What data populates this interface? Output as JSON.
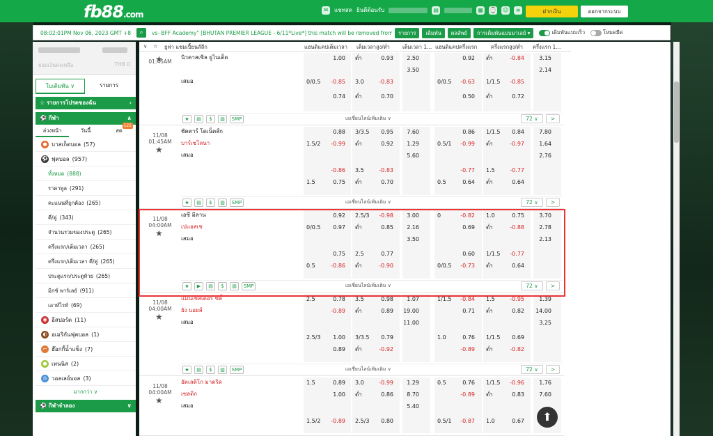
{
  "header": {
    "logo": "fb88",
    "logo_suffix": ".com",
    "chat": "แชทสด",
    "welcome": "ยินดีต้อนรับ",
    "deposit": "ฝากเงิน",
    "logout": "ออกจากระบบ"
  },
  "topbar": {
    "time": "08:02:01PM Nov 06, 2023 GMT +8",
    "ticker": "vs- BFF Academy\" [BHUTAN PREMIER LEAGUE - 6/11*Live*] this match will be removed from",
    "btn_items": "รายการ",
    "btn_parlay": "เดิมพัน",
    "btn_result": "ผลลัพธ์",
    "btn_pref": "การเดิมพันแบบมาเลย์ ▾",
    "toggle1": "เดิมพันแบบเร็ว",
    "toggle2": "โหมดมืด"
  },
  "sidebar": {
    "balance_label": "ยอดเงินคงเหลือ",
    "balance_value": "THB 0",
    "tab_betslip": "ใบเดิมพัน",
    "tab_items": "รายการ",
    "favorites": "รายการโปรดของฉัน",
    "sports": "กีฬา",
    "sub_tabs": [
      "ล่วงหน้า",
      "วันนี้",
      "สด"
    ],
    "live_badge": "125",
    "items": [
      {
        "label": "บาสเก็ตบอล",
        "count": "(57)"
      },
      {
        "label": "ฟุตบอล",
        "count": "(957)"
      }
    ],
    "football_sub": [
      {
        "label": "ทั้งหมด",
        "count": "(888)"
      },
      {
        "label": "ราคาพูล",
        "count": "(291)"
      },
      {
        "label": "คะแนนที่ถูกต้อง",
        "count": "(265)"
      },
      {
        "label": "คี่/คู่",
        "count": "(343)"
      },
      {
        "label": "จำนวนรวมของประตู",
        "count": "(265)"
      },
      {
        "label": "ครึ่งแรก/เต็มเวลา",
        "count": "(265)"
      },
      {
        "label": "ครึ่งแรก/เต็มเวลา คี่/คู่",
        "count": "(265)"
      },
      {
        "label": "ประตูแรก/ประตูท้าย",
        "count": "(265)"
      },
      {
        "label": "มิกซ์ พาร์เลย์",
        "count": "(911)"
      },
      {
        "label": "เอาท์ไรท์",
        "count": "(69)"
      }
    ],
    "other": [
      {
        "label": "อีสปอร์ต",
        "count": "(11)"
      },
      {
        "label": "อเมริกันฟุตบอล",
        "count": "(1)"
      },
      {
        "label": "ฮ๊อกกี้น้ำแข็ง",
        "count": "(7)"
      },
      {
        "label": "เทนนิส",
        "count": "(2)"
      },
      {
        "label": "วอลเลย์บอล",
        "count": "(3)"
      }
    ],
    "more": "มากกว่า",
    "virtual": "กีฬาจำลอง"
  },
  "colhdr": {
    "c1": "ยูฟ่า แชมเปี้ยนส์ลีก",
    "c2": "แฮนดิแคปเต็มเวลา",
    "c3": "เต็มเวลาสูง/ต่ำ",
    "c4": "เต็มเวลา 1...",
    "c5": "แฮนดิแคปครึ่งแรก",
    "c6": "ครึ่งแรกสูง/ต่ำ",
    "c7": "ครึ่งแรก 1..."
  },
  "matches": [
    {
      "date": "",
      "time": "01:45AM",
      "home": "นิวคาสเซิล ยูไนเต็ด",
      "away": "",
      "draw": "เสมอ",
      "red_home": false,
      "l1": {
        "hc": "",
        "hv": "1.00",
        "ou": "ต่ำ",
        "ouv": "0.93",
        "x": "2.50",
        "fh": "",
        "fhv": "0.92",
        "fou": "ต่ำ",
        "fouv": "-0.84",
        "fx": "3.15"
      },
      "l2": {
        "x": "3.50",
        "fx": "2.14"
      },
      "l3": {
        "hc": "0/0.5",
        "hv": "-0.85",
        "ou": "3.0",
        "ouv": "-0.83",
        "fh": "0/0.5",
        "fhv": "-0.63",
        "fou": "1/1.5",
        "fouv": "-0.85"
      },
      "l4": {
        "hv": "0.74",
        "ou": "ต่ำ",
        "ouv": "0.70",
        "fhv": "0.50",
        "fou": "ต่ำ",
        "fouv": "0.72"
      },
      "more": "เอเชี่ยนไลน์เพิ่มเติม",
      "count": "72"
    },
    {
      "date": "11/08",
      "time": "01:45AM",
      "home": "ชัคตาร์ โดเน็ตส์ก",
      "away": "บาร์เซโลนา",
      "draw": "เสมอ",
      "l1": {
        "hc": "",
        "hv": "0.88",
        "ou": "3/3.5",
        "ouv": "0.95",
        "x": "7.60",
        "fh": "",
        "fhv": "0.86",
        "fou": "1/1.5",
        "fouv": "0.84",
        "fx": "7.80"
      },
      "l2": {
        "hc": "1.5/2",
        "hv": "-0.99",
        "ou": "ต่ำ",
        "ouv": "0.92",
        "x": "1.29",
        "fh": "0.5/1",
        "fhv": "-0.99",
        "fou": "ต่ำ",
        "fouv": "-0.97",
        "fx": "1.64"
      },
      "l3": {
        "x": "5.60",
        "fx": "2.76"
      },
      "l4": {
        "hv": "-0.86",
        "ou": "3.5",
        "ouv": "-0.83",
        "fhv": "-0.77",
        "fou": "1.5",
        "fouv": "-0.77"
      },
      "l5": {
        "hc": "1.5",
        "hv": "0.75",
        "ou": "ต่ำ",
        "ouv": "0.70",
        "fh": "0.5",
        "fhv": "0.64",
        "fou": "ต่ำ",
        "fouv": "0.64"
      },
      "more": "เอเชี่ยนไลน์เพิ่มเติม",
      "count": "72"
    },
    {
      "date": "11/08",
      "time": "04:00AM",
      "home": "เอซี มิลาน",
      "away": "เปแอสเช",
      "draw": "เสมอ",
      "l1": {
        "hv": "0.92",
        "ou": "2.5/3",
        "ouv": "-0.98",
        "x": "3.00",
        "fh": "0",
        "fhv": "-0.82",
        "fou": "1.0",
        "fouv": "0.75",
        "fx": "3.70"
      },
      "l2": {
        "hc": "0/0.5",
        "hv": "0.97",
        "ou": "ต่ำ",
        "ouv": "0.85",
        "x": "2.16",
        "fhv": "0.69",
        "fou": "ต่ำ",
        "fouv": "-0.88",
        "fx": "2.78"
      },
      "l3": {
        "x": "3.50",
        "fx": "2.13"
      },
      "l4": {
        "hv": "0.75",
        "ou": "2.5",
        "ouv": "0.77",
        "fhv": "0.60",
        "fou": "1/1.5",
        "fouv": "-0.77"
      },
      "l5": {
        "hc": "0.5",
        "hv": "-0.86",
        "ou": "ต่ำ",
        "ouv": "-0.90",
        "fh": "0/0.5",
        "fhv": "-0.73",
        "fou": "ต่ำ",
        "fouv": "0.64"
      },
      "more": "เอเชี่ยนไลน์เพิ่มเติม",
      "count": "72"
    },
    {
      "date": "11/08",
      "time": "04:00AM",
      "home": "แมนเชสเตอร์ ซิตี้",
      "away": "ยัง บอยส์",
      "draw": "เสมอ",
      "l1": {
        "hc": "2.5",
        "hv": "0.78",
        "ou": "3.5",
        "ouv": "0.98",
        "x": "1.07",
        "fh": "1/1.5",
        "fhv": "-0.84",
        "fou": "1.5",
        "fouv": "-0.95",
        "fx": "1.39"
      },
      "l2": {
        "hv": "-0.89",
        "ou": "ต่ำ",
        "ouv": "0.89",
        "x": "19.00",
        "fhv": "0.71",
        "fou": "ต่ำ",
        "fouv": "0.82",
        "fx": "14.00"
      },
      "l3": {
        "x": "11.00",
        "fx": "3.25"
      },
      "l4": {
        "hc": "2.5/3",
        "hv": "1.00",
        "ou": "3/3.5",
        "ouv": "0.79",
        "fh": "1.0",
        "fhv": "0.76",
        "fou": "1/1.5",
        "fouv": "0.69"
      },
      "l5": {
        "hv": "0.89",
        "ou": "ต่ำ",
        "ouv": "-0.92",
        "fhv": "-0.89",
        "fou": "ต่ำ",
        "fouv": "-0.82"
      },
      "more": "เอเชี่ยนไลน์เพิ่มเติม",
      "count": "72"
    },
    {
      "date": "11/08",
      "time": "04:00AM",
      "home": "อัตเลติโก มาดริด",
      "away": "เซลติก",
      "draw": "เสมอ",
      "l1": {
        "hc": "1.5",
        "hv": "0.89",
        "ou": "3.0",
        "ouv": "-0.99",
        "x": "1.29",
        "fh": "0.5",
        "fhv": "0.76",
        "fou": "1/1.5",
        "fouv": "-0.96",
        "fx": "1.76"
      },
      "l2": {
        "hv": "1.00",
        "ou": "ต่ำ",
        "ouv": "0.86",
        "x": "8.70",
        "fhv": "-0.89",
        "fou": "ต่ำ",
        "fouv": "0.83",
        "fx": "7.60"
      },
      "l3": {
        "x": "5.40"
      },
      "l4": {
        "hc": "1.5/2",
        "hv": "-0.89",
        "ou": "2.5/3",
        "ouv": "0.80",
        "fh": "0.5/1",
        "fhv": "-0.87",
        "fou": "1.0",
        "fouv": "0.67"
      }
    }
  ],
  "smp": "SMP",
  "arrow": ">",
  "colors": {
    "green": "#1b9b47",
    "red": "#d42626",
    "header": "#14a849"
  }
}
